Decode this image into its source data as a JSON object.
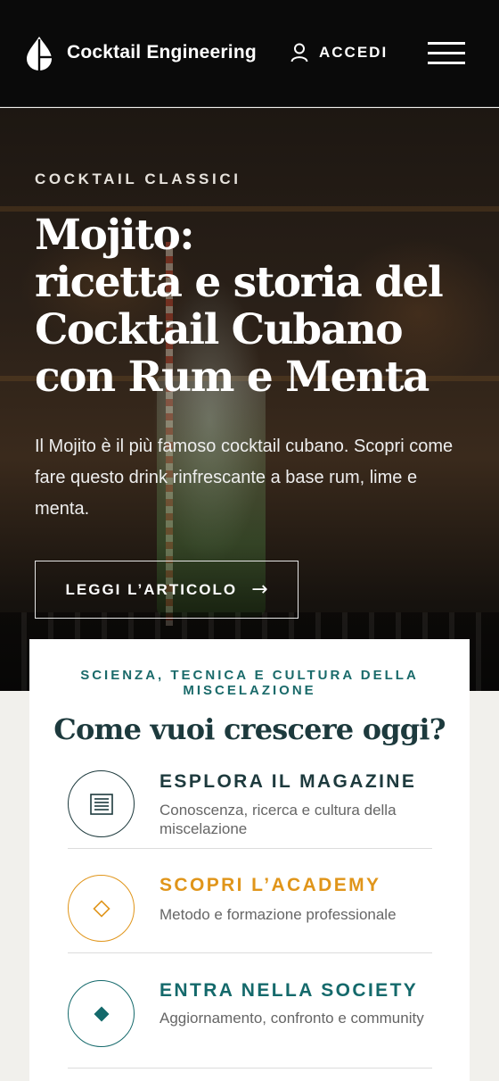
{
  "header": {
    "brand": "Cocktail Engineering",
    "login_label": "ACCEDI"
  },
  "hero": {
    "kicker": "COCKTAIL CLASSICI",
    "title_lines": [
      "Mojito:",
      "ricetta e storia del",
      "Cocktail Cubano",
      "con Rum e Menta"
    ],
    "description": "Il Mojito è il più famoso cocktail cubano. Scopri come fare questo drink rinfrescante a base rum, lime e menta.",
    "cta_label": "LEGGI L’ARTICOLO",
    "cta_arrow": "→"
  },
  "paths": {
    "kicker": "SCIENZA, TECNICA E CULTURA DELLA MISCELAZIONE",
    "title": "Come vuoi crescere oggi?",
    "items": [
      {
        "title": "ESPLORA IL MAGAZINE",
        "description": "Conoscenza, ricerca e cultura della miscelazione",
        "icon": "magazine-icon",
        "color": "#1d3a3d"
      },
      {
        "title": "SCOPRI L’ACADEMY",
        "description": "Metodo e formazione professionale",
        "icon": "diamond-outline-icon",
        "color": "#e0951a"
      },
      {
        "title": "ENTRA NELLA SOCIETY",
        "description": "Aggiornamento, confronto e community",
        "icon": "diamond-filled-icon",
        "color": "#14696b"
      }
    ]
  },
  "colors": {
    "header_bg": "#0a0a0a",
    "teal_accent": "#1a6a6a",
    "orange_accent": "#e0951a",
    "page_bg": "#f1f0ec"
  }
}
